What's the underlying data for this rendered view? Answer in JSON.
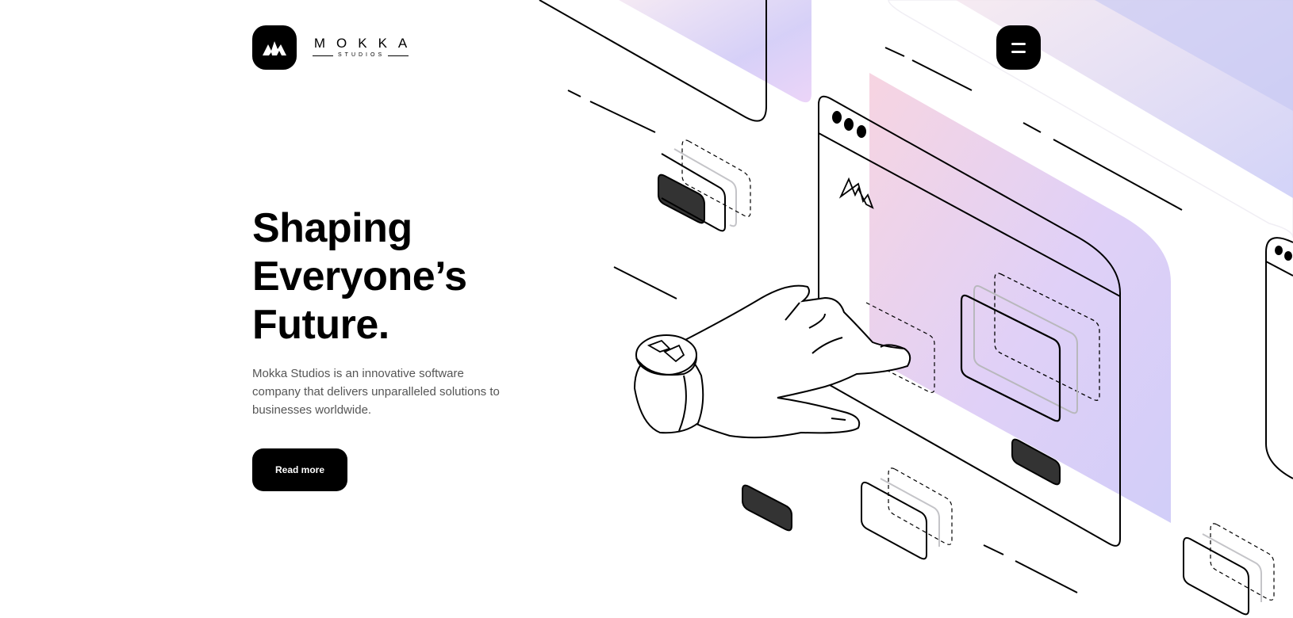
{
  "brand": {
    "name": "MOKKA",
    "subtitle": "STUDIOS"
  },
  "header": {
    "menu_icon": "hamburger-menu-icon"
  },
  "hero": {
    "title_lines": [
      "Shaping",
      "Everyone’s",
      "Future."
    ],
    "description": "Mokka Studios is an innovative software company that delivers unparalleled solutions to businesses worldwide.",
    "cta_label": "Read more"
  },
  "colors": {
    "primary": "#000000",
    "background": "#ffffff",
    "body_text": "#555555",
    "gradient_pink": "#f7c6d6",
    "gradient_lavender": "#dccbf6",
    "gradient_periwinkle": "#c8c8f6"
  }
}
